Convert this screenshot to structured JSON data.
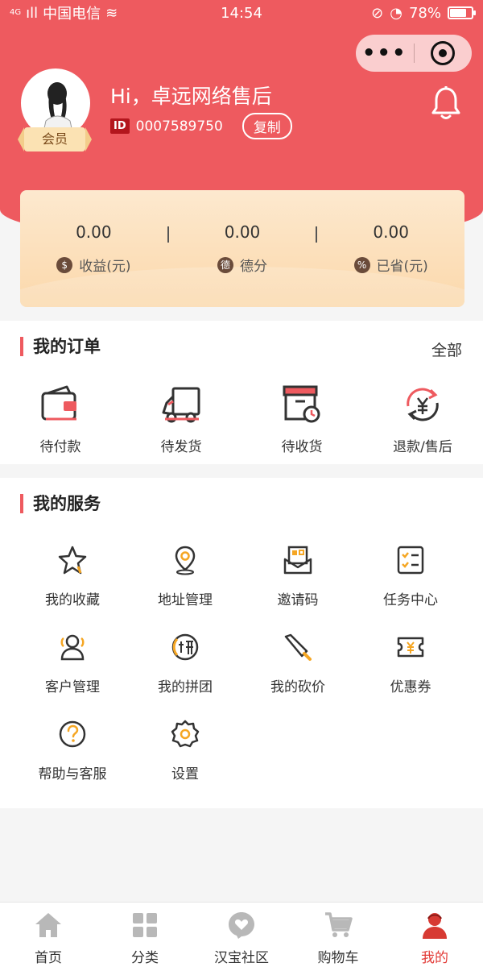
{
  "status_bar": {
    "network": "4G",
    "carrier": "中国电信",
    "time": "14:54",
    "battery": "78%",
    "battery_level": 0.78
  },
  "profile": {
    "greeting": "Hi，卓远网络售后",
    "member_badge": "会员",
    "id_tag": "ID",
    "user_id": "0007589750",
    "copy_label": "复制"
  },
  "stats": [
    {
      "value": "0.00",
      "label": "收益(元)",
      "icon": "money-bag-icon",
      "glyph": "$"
    },
    {
      "value": "0.00",
      "label": "德分",
      "icon": "de-points-icon",
      "glyph": "德"
    },
    {
      "value": "0.00",
      "label": "已省(元)",
      "icon": "price-tag-icon",
      "glyph": "%"
    }
  ],
  "orders": {
    "title": "我的订单",
    "see_all": "全部",
    "items": [
      {
        "label": "待付款",
        "icon": "wallet-icon"
      },
      {
        "label": "待发货",
        "icon": "truck-icon"
      },
      {
        "label": "待收货",
        "icon": "package-clock-icon"
      },
      {
        "label": "退款/售后",
        "icon": "refund-icon"
      }
    ]
  },
  "services": {
    "title": "我的服务",
    "items": [
      {
        "label": "我的收藏",
        "icon": "star-icon"
      },
      {
        "label": "地址管理",
        "icon": "location-pin-icon"
      },
      {
        "label": "邀请码",
        "icon": "invite-qr-icon"
      },
      {
        "label": "任务中心",
        "icon": "task-list-icon"
      },
      {
        "label": "客户管理",
        "icon": "customers-icon"
      },
      {
        "label": "我的拼团",
        "icon": "group-buy-icon"
      },
      {
        "label": "我的砍价",
        "icon": "bargain-knife-icon"
      },
      {
        "label": "优惠券",
        "icon": "coupon-icon"
      },
      {
        "label": "帮助与客服",
        "icon": "help-icon"
      },
      {
        "label": "设置",
        "icon": "settings-gear-icon"
      }
    ]
  },
  "bottom_nav": [
    {
      "label": "首页",
      "icon": "home-icon",
      "active": false
    },
    {
      "label": "分类",
      "icon": "grid-icon",
      "active": false
    },
    {
      "label": "汉宝社区",
      "icon": "community-heart-icon",
      "active": false
    },
    {
      "label": "购物车",
      "icon": "cart-icon",
      "active": false
    },
    {
      "label": "我的",
      "icon": "profile-icon",
      "active": true
    }
  ],
  "colors": {
    "brand_red": "#ee5a5f",
    "accent_orange": "#f5a623",
    "active_nav": "#e23a36"
  }
}
